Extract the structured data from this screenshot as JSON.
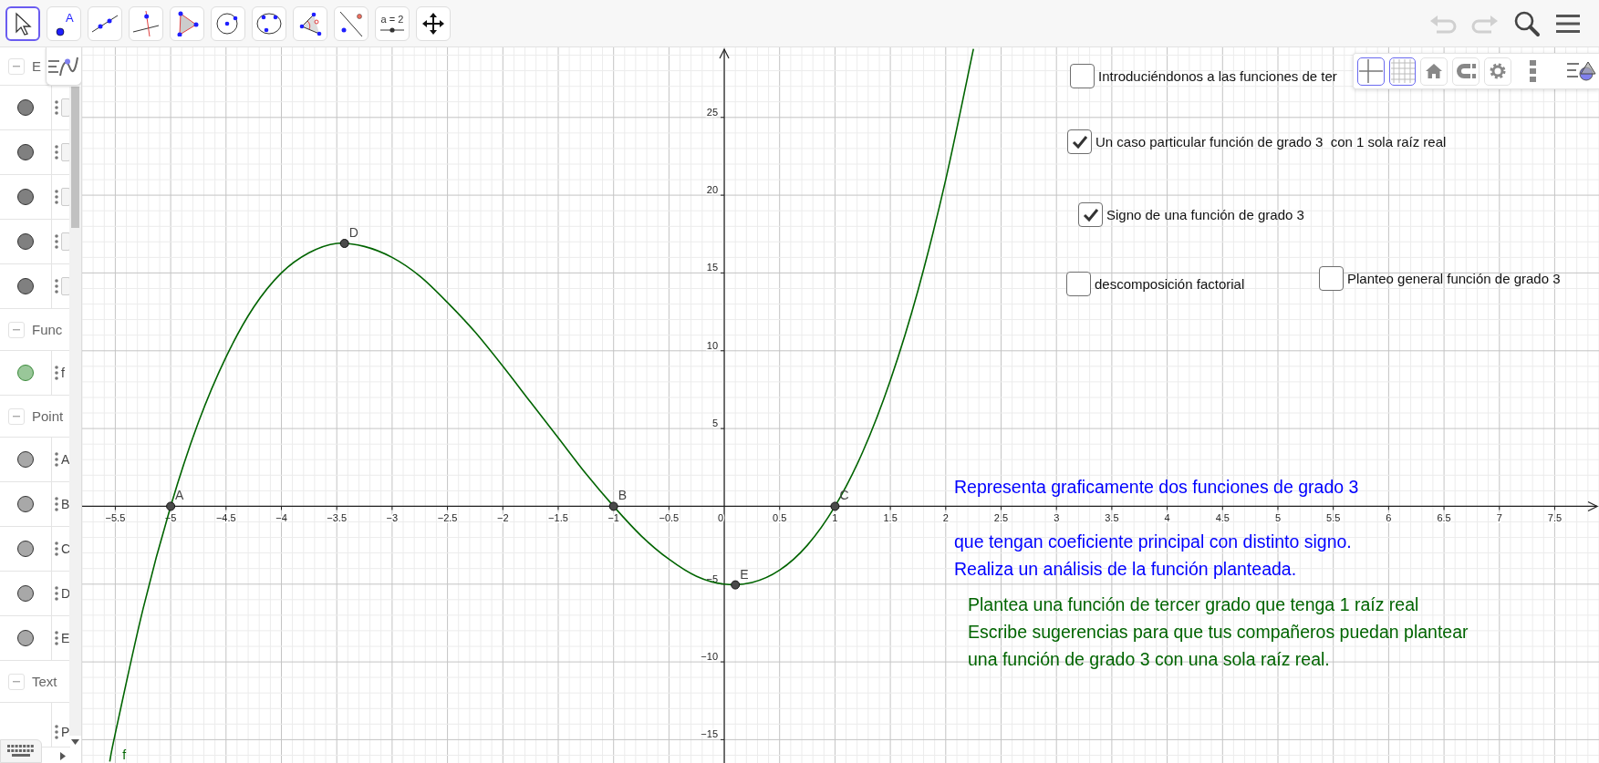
{
  "toolbar": {
    "tools": [
      {
        "kind": "move",
        "selected": true
      },
      {
        "kind": "point",
        "label": "A",
        "selected": false
      },
      {
        "kind": "line",
        "selected": false
      },
      {
        "kind": "perpendicular",
        "selected": false
      },
      {
        "kind": "polygon",
        "selected": false
      },
      {
        "kind": "circle",
        "selected": false
      },
      {
        "kind": "circle3",
        "selected": false
      },
      {
        "kind": "angle",
        "selected": false
      },
      {
        "kind": "reflect",
        "selected": false
      },
      {
        "kind": "slider",
        "label": "a = 2",
        "selected": false
      },
      {
        "kind": "move_view",
        "selected": false
      }
    ],
    "actions": [
      {
        "kind": "undo",
        "disabled": true
      },
      {
        "kind": "redo",
        "disabled": true
      },
      {
        "kind": "search",
        "disabled": false
      },
      {
        "kind": "menu",
        "disabled": false
      }
    ]
  },
  "algebra": {
    "sections": [
      {
        "title": "E",
        "rows": [
          {
            "kind": "boolean",
            "color": "#808080"
          },
          {
            "kind": "boolean",
            "color": "#808080"
          },
          {
            "kind": "boolean",
            "color": "#808080"
          },
          {
            "kind": "boolean",
            "color": "#808080"
          },
          {
            "kind": "boolean",
            "color": "#808080"
          }
        ]
      },
      {
        "title": "Func",
        "rows": [
          {
            "kind": "function",
            "color": "#99c799",
            "text": "f"
          }
        ]
      },
      {
        "title": "Point",
        "rows": [
          {
            "kind": "point",
            "color": "#a8a8a8",
            "text": "A"
          },
          {
            "kind": "point",
            "color": "#a8a8a8",
            "text": "B"
          },
          {
            "kind": "point",
            "color": "#a8a8a8",
            "text": "C"
          },
          {
            "kind": "point",
            "color": "#a8a8a8",
            "text": "D"
          },
          {
            "kind": "point",
            "color": "#a8a8a8",
            "text": "E"
          }
        ]
      },
      {
        "title": "Text",
        "rows": [
          {
            "kind": "text",
            "text": "P"
          }
        ]
      }
    ]
  },
  "graphics": {
    "style_bar": [
      {
        "kind": "axes",
        "selected": true
      },
      {
        "kind": "grid",
        "selected": true
      },
      {
        "kind": "home",
        "selected": false
      },
      {
        "kind": "capture",
        "selected": false
      },
      {
        "kind": "settings",
        "selected": false
      },
      {
        "kind": "more"
      },
      {
        "kind": "style"
      }
    ],
    "checkboxes": [
      {
        "label": "Introduciéndonos a las funciones de ter",
        "checked": false
      },
      {
        "label": "Un caso particular función de grado 3  con 1 sola raíz real",
        "checked": true
      },
      {
        "label": "Signo de una función de grado 3",
        "checked": true
      },
      {
        "label": "descomposición factorial",
        "checked": false
      },
      {
        "label": "Planteo general función de grado 3",
        "checked": false
      }
    ],
    "texts": [
      {
        "color": "#0000ff",
        "lines": [
          "Representa graficamente dos funciones de grado 3",
          "que tengan coeficiente principal con distinto signo.",
          "Realiza un análisis de la función planteada."
        ]
      },
      {
        "color": "#006400",
        "lines": [
          "Plantea una función de tercer grado que tenga 1 raíz real",
          "Escribe sugerencias para que tus compañeros puedan plantear",
          "una función de grado 3 con una sola raíz real."
        ]
      }
    ],
    "chart_data": {
      "type": "line",
      "grid": true,
      "xlim": [
        -5.8,
        7.9
      ],
      "ylim": [
        -16.5,
        29.5
      ],
      "xticks": [
        {
          "value": -5.5,
          "label": "−5.5"
        },
        {
          "value": -5,
          "label": "−5"
        },
        {
          "value": -4.5,
          "label": "−4.5"
        },
        {
          "value": -4,
          "label": "−4"
        },
        {
          "value": -3.5,
          "label": "−3.5"
        },
        {
          "value": -3,
          "label": "−3"
        },
        {
          "value": -2.5,
          "label": "−2.5"
        },
        {
          "value": -2,
          "label": "−2"
        },
        {
          "value": -1.5,
          "label": "−1.5"
        },
        {
          "value": -1,
          "label": "−1"
        },
        {
          "value": -0.5,
          "label": "−0.5"
        },
        {
          "value": 0,
          "label": "0"
        },
        {
          "value": 0.5,
          "label": "0.5"
        },
        {
          "value": 1,
          "label": "1"
        },
        {
          "value": 1.5,
          "label": "1.5"
        },
        {
          "value": 2,
          "label": "2"
        },
        {
          "value": 2.5,
          "label": "2.5"
        },
        {
          "value": 3,
          "label": "3"
        },
        {
          "value": 3.5,
          "label": "3.5"
        },
        {
          "value": 4,
          "label": "4"
        },
        {
          "value": 4.5,
          "label": "4.5"
        },
        {
          "value": 5,
          "label": "5"
        },
        {
          "value": 5.5,
          "label": "5.5"
        },
        {
          "value": 6,
          "label": "6"
        },
        {
          "value": 6.5,
          "label": "6.5"
        },
        {
          "value": 7,
          "label": "7"
        },
        {
          "value": 7.5,
          "label": "7.5"
        }
      ],
      "yticks": [
        {
          "value": -15,
          "label": "−15"
        },
        {
          "value": -10,
          "label": "−10"
        },
        {
          "value": -5,
          "label": "−5"
        },
        {
          "value": 5,
          "label": "5"
        },
        {
          "value": 10,
          "label": "10"
        },
        {
          "value": 15,
          "label": "15"
        },
        {
          "value": 20,
          "label": "20"
        },
        {
          "value": 25,
          "label": "25"
        }
      ],
      "x": [
        -5.55,
        -5.5,
        -5.25,
        -5,
        -4.75,
        -4.5,
        -4.25,
        -4,
        -3.75,
        -3.5,
        -3.25,
        -3,
        -2.75,
        -2.5,
        -2.25,
        -2,
        -1.75,
        -1.5,
        -1.25,
        -1,
        -0.75,
        -0.5,
        -0.25,
        0,
        0.25,
        0.5,
        0.75,
        1,
        1.25,
        1.5,
        1.75,
        2,
        2.25
      ],
      "series": [
        {
          "name": "f",
          "color": "#006400",
          "values": [
            -16.4,
            -14.6,
            -6.6,
            0,
            5.4,
            9.6,
            12.8,
            15,
            16.3,
            16.9,
            16.7,
            16,
            14.8,
            13.1,
            11.2,
            9,
            6.7,
            4.4,
            2.1,
            0,
            -1.9,
            -3.4,
            -4.5,
            -5,
            -4.9,
            -4.1,
            -2.5,
            0,
            3.5,
            8.1,
            13.9,
            21,
            29.4
          ]
        }
      ],
      "annotations": [
        {
          "text": "A",
          "x": -5,
          "y": 0
        },
        {
          "text": "B",
          "x": -1,
          "y": 0
        },
        {
          "text": "C",
          "x": 1,
          "y": 0
        },
        {
          "text": "D",
          "x": -3.43,
          "y": 16.9
        },
        {
          "text": "E",
          "x": 0.1,
          "y": -5.05
        }
      ]
    }
  }
}
